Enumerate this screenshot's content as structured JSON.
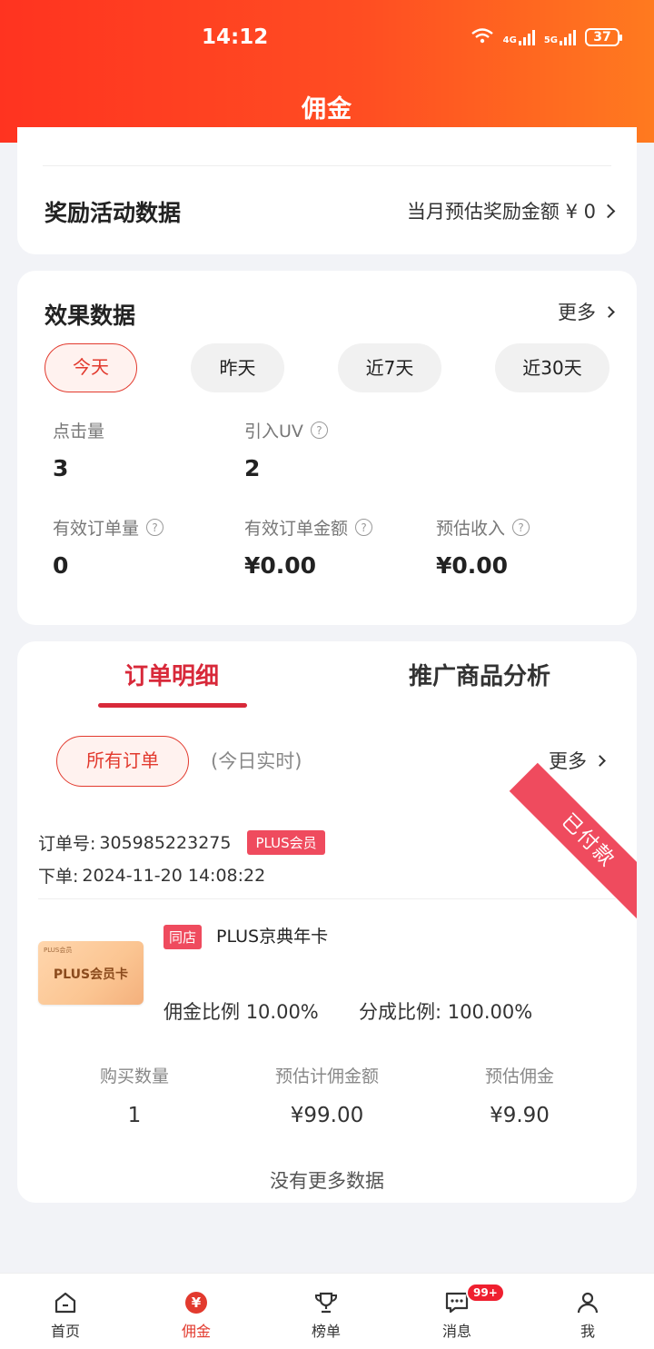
{
  "status_bar": {
    "time": "14:12",
    "network_1": "4G",
    "network_2": "5G",
    "battery": "37"
  },
  "header": {
    "title": "佣金"
  },
  "reward_section": {
    "title": "奖励活动数据",
    "summary": "当月预估奖励金额 ¥ 0"
  },
  "effect_section": {
    "title": "效果数据",
    "more": "更多",
    "ranges": [
      "今天",
      "昨天",
      "近7天",
      "近30天"
    ],
    "active_range": "今天",
    "metrics": {
      "clicks": {
        "label": "点击量",
        "value": "3"
      },
      "uv": {
        "label": "引入UV",
        "value": "2"
      },
      "valid_orders": {
        "label": "有效订单量",
        "value": "0"
      },
      "valid_amount": {
        "label": "有效订单金额",
        "value": "¥0.00"
      },
      "est_income": {
        "label": "预估收入",
        "value": "¥0.00"
      }
    }
  },
  "orders_section": {
    "tabs": [
      "订单明细",
      "推广商品分析"
    ],
    "active_tab": "订单明细",
    "filter_label": "所有订单",
    "realtime_label": "(今日实时)",
    "more": "更多",
    "order": {
      "status": "已付款",
      "order_no_label": "订单号:",
      "order_no": "305985223275",
      "member_badge": "PLUS会员",
      "placed_label": "下单:",
      "placed_time": "2024-11-20 14:08:22",
      "product": {
        "image_brand": "PLUS会员",
        "image_title": "PLUS会员卡",
        "store_badge": "同店",
        "name": "PLUS京典年卡",
        "commission_rate_label": "佣金比例",
        "commission_rate": "10.00%",
        "share_rate_label": "分成比例:",
        "share_rate": "100.00%"
      },
      "stats": [
        {
          "label": "购买数量",
          "value": "1"
        },
        {
          "label": "预估计佣金额",
          "value": "¥99.00"
        },
        {
          "label": "预估佣金",
          "value": "¥9.90"
        }
      ]
    },
    "no_more": "没有更多数据"
  },
  "bottom_nav": {
    "items": [
      {
        "label": "首页",
        "icon": "home-icon"
      },
      {
        "label": "佣金",
        "icon": "yen-coin-icon"
      },
      {
        "label": "榜单",
        "icon": "trophy-icon"
      },
      {
        "label": "消息",
        "icon": "message-icon"
      },
      {
        "label": "我",
        "icon": "profile-icon"
      }
    ],
    "active": "佣金",
    "message_badge": "99+"
  },
  "colors": {
    "accent": "#e23a2e",
    "header_start": "#ff3320",
    "header_end": "#ff7a1f",
    "badge": "#ef4b5e"
  }
}
